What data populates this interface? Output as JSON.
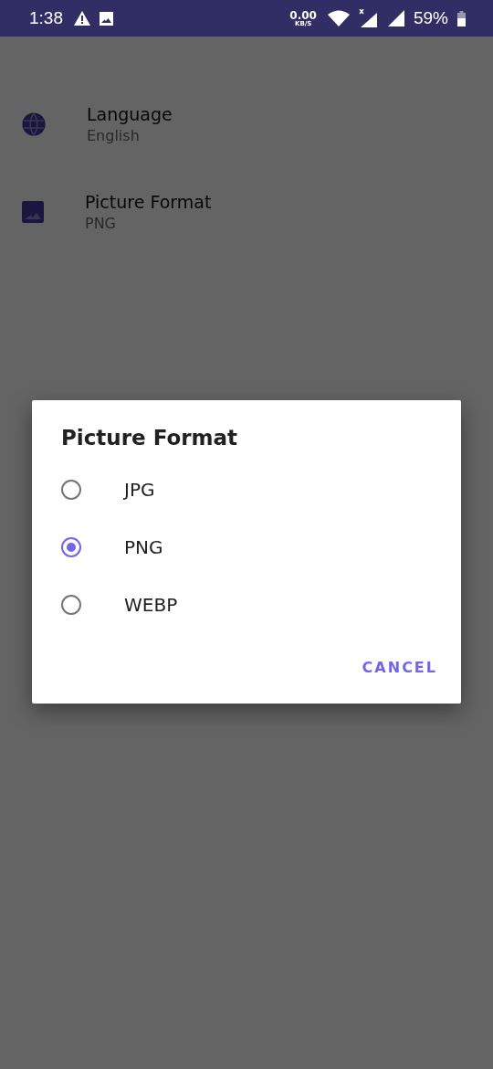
{
  "status_bar": {
    "time": "1:38",
    "net_speed": "0.00",
    "net_unit": "KB/S",
    "battery": "59%"
  },
  "settings": [
    {
      "kind": "globe",
      "label": "Language",
      "value": "English"
    },
    {
      "kind": "image",
      "label": "Picture Format",
      "value": "PNG"
    }
  ],
  "dialog": {
    "title": "Picture Format",
    "options": [
      {
        "label": "JPG",
        "selected": false
      },
      {
        "label": "PNG",
        "selected": true
      },
      {
        "label": "WEBP",
        "selected": false
      }
    ],
    "button": "CANCEL"
  }
}
